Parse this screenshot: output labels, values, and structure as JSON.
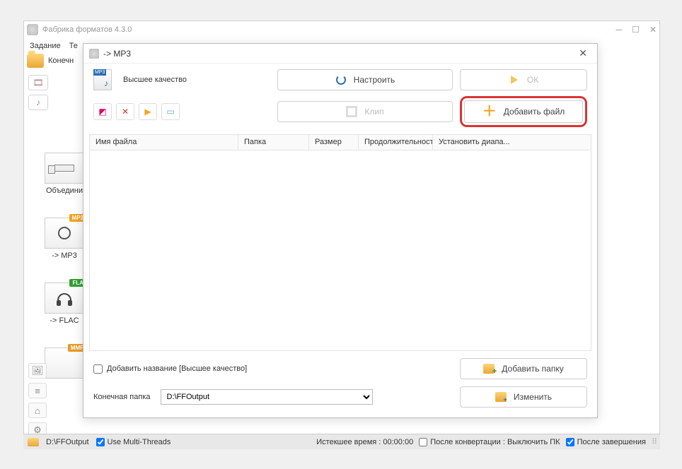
{
  "main": {
    "title": "Фабрика форматов 4.3.0",
    "menu": {
      "task": "Задание",
      "te": "Те"
    },
    "toolbar": {
      "dest_label": "Конечн"
    },
    "shortcuts": {
      "join": "Объедини",
      "mp3": "-> MP3",
      "flac": "-> FLAC",
      "mmf": ""
    },
    "winbtns": {
      "min": "─",
      "max": "☐",
      "close": "✕"
    }
  },
  "dialog": {
    "title": "-> MP3",
    "quality_label": "Высшее качество",
    "buttons": {
      "configure": "Настроить",
      "ok": "ОК",
      "clip": "Клип",
      "add_file": "Добавить файл",
      "add_folder": "Добавить папку",
      "change": "Изменить"
    },
    "table": {
      "cols": {
        "filename": "Имя файла",
        "folder": "Папка",
        "size": "Размер",
        "duration": "Продолжительность",
        "range": "Установить диапа..."
      }
    },
    "add_title_checkbox": "Добавить название [Высшее качество]",
    "dest_label": "Конечная папка",
    "dest_value": "D:\\FFOutput"
  },
  "status": {
    "path": "D:\\FFOutput",
    "multithread": "Use Multi-Threads",
    "elapsed": "Истекшее время : 00:00:00",
    "after_conv": "После конвертации : Выключить ПК",
    "after_done": "После завершения"
  }
}
